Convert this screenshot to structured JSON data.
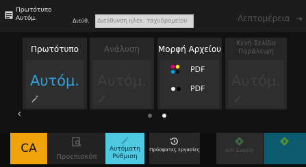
{
  "topbar": {
    "title": "Πρωτότυπο Αυτόμ.",
    "address_label": "Διεύθ.",
    "address_placeholder": "Διεύθυνση ηλεκ. ταχυδρομείου",
    "details_label": "Λεπτομέρεια"
  },
  "tiles": {
    "original": {
      "title": "Πρωτότυπο",
      "value": "Αυτόμ."
    },
    "resolution": {
      "title": "Ανάλυση",
      "value": "Αυτόμ."
    },
    "file_format": {
      "title": "Μορφή Αρχείου",
      "color_value": "PDF",
      "bw_value": "PDF"
    },
    "blank_page_skip": {
      "title": "Κενή Σελίδα Παράλειψη",
      "value": "Αυτόμ."
    }
  },
  "pager": {
    "pages": 2,
    "current": 2
  },
  "bottombar": {
    "ca_label": "CA",
    "preview_label": "Προεπισκόπ",
    "auto_setup_label": "Αυτόματη Ρύθμιση",
    "recent_jobs_label": "Πρόσφατες εργασίες",
    "bw_start_label": "Α/Μ Έναρξη"
  },
  "colors": {
    "accent_blue": "#2da2dc",
    "ca_orange": "#f0a30a",
    "auto_cyan": "#4fc9e2"
  }
}
